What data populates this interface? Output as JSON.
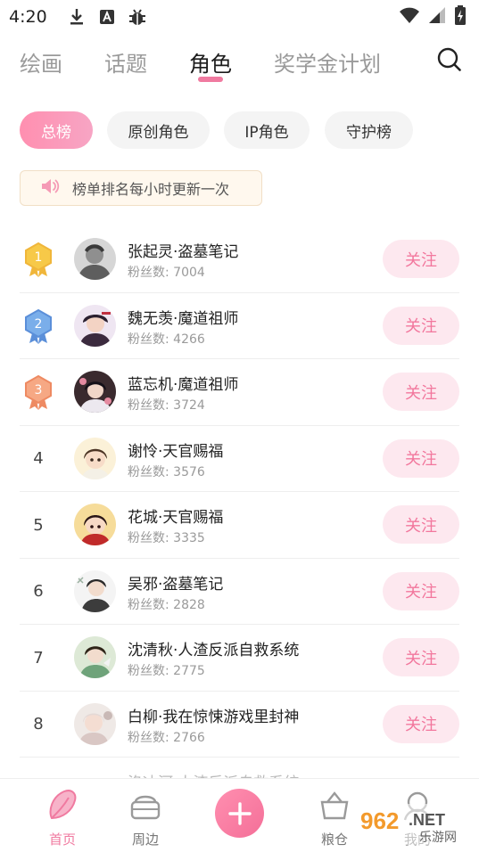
{
  "status_bar": {
    "time": "4:20"
  },
  "top_tabs": [
    {
      "label": "绘画"
    },
    {
      "label": "话题"
    },
    {
      "label": "角色"
    },
    {
      "label": "奖学金计划"
    }
  ],
  "chips": [
    {
      "label": "总榜"
    },
    {
      "label": "原创角色"
    },
    {
      "label": "IP角色"
    },
    {
      "label": "守护榜"
    }
  ],
  "notice": {
    "text": "榜单排名每小时更新一次"
  },
  "ranking": [
    {
      "rank": "1",
      "name": "张起灵·盗墓笔记",
      "fans": "粉丝数: 7004",
      "follow": "关注"
    },
    {
      "rank": "2",
      "name": "魏无羡·魔道祖师",
      "fans": "粉丝数: 4266",
      "follow": "关注"
    },
    {
      "rank": "3",
      "name": "蓝忘机·魔道祖师",
      "fans": "粉丝数: 3724",
      "follow": "关注"
    },
    {
      "rank": "4",
      "name": "谢怜·天官赐福",
      "fans": "粉丝数: 3576",
      "follow": "关注"
    },
    {
      "rank": "5",
      "name": "花城·天官赐福",
      "fans": "粉丝数: 3335",
      "follow": "关注"
    },
    {
      "rank": "6",
      "name": "吴邪·盗墓笔记",
      "fans": "粉丝数: 2828",
      "follow": "关注"
    },
    {
      "rank": "7",
      "name": "沈清秋·人渣反派自救系统",
      "fans": "粉丝数: 2775",
      "follow": "关注"
    },
    {
      "rank": "8",
      "name": "白柳·我在惊悚游戏里封神",
      "fans": "粉丝数: 2766",
      "follow": "关注"
    }
  ],
  "ranking_peek": {
    "name": "洛冰河·人渣反派自救系统"
  },
  "bottom_nav": [
    {
      "label": "首页"
    },
    {
      "label": "周边"
    },
    {
      "label": "粮仓"
    },
    {
      "label": "我的"
    }
  ],
  "watermark": {
    "number": "962",
    "domain": ".NET",
    "sub": "乐游网"
  },
  "colors": {
    "accent": "#f07aa0",
    "follow_bg": "#fde8ef",
    "gold": "#f5c542",
    "silver": "#6e9fe0",
    "bronze": "#f29a72"
  }
}
